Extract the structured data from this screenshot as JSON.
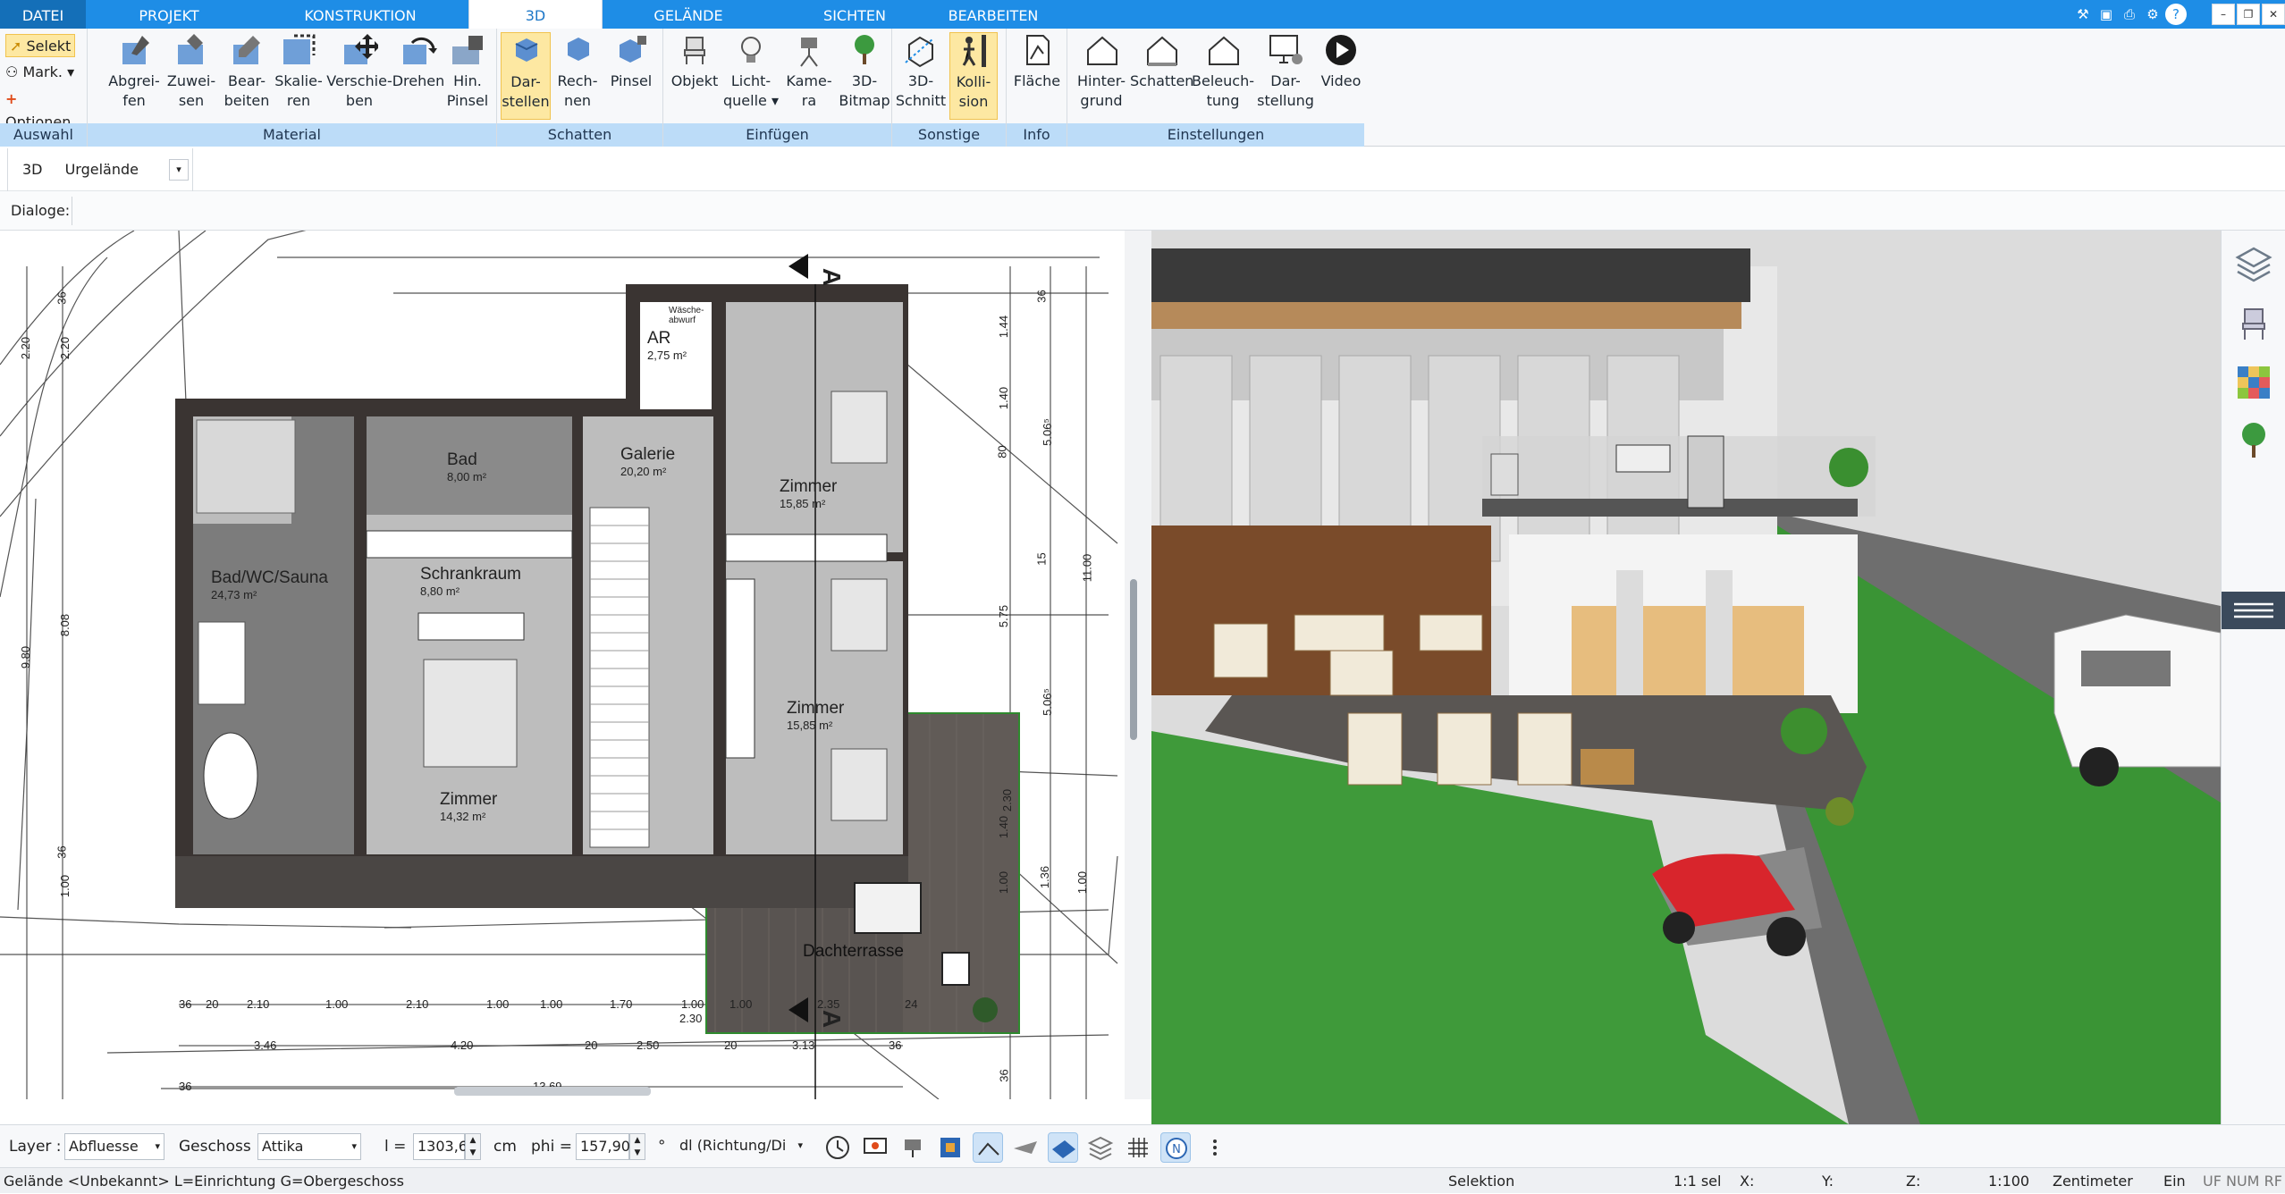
{
  "tabs": [
    "DATEI",
    "PROJEKT",
    "KONSTRUKTION",
    "3D",
    "GELÄNDE",
    "SICHTEN",
    "BEARBEITEN"
  ],
  "active_tab": "3D",
  "window_icons": [
    "tools-icon",
    "window-icon",
    "print-icon",
    "settings-icon",
    "help-icon",
    "minimize-icon",
    "restore-icon",
    "close-icon"
  ],
  "ribbon": {
    "auswahl": {
      "label": "Auswahl",
      "selekt": "Selekt",
      "mark": "Mark.",
      "optionen": "Optionen"
    },
    "material": {
      "label": "Material",
      "buttons": [
        {
          "l1": "Abgrei-",
          "l2": "fen"
        },
        {
          "l1": "Zuwei-",
          "l2": "sen"
        },
        {
          "l1": "Bear-",
          "l2": "beiten"
        },
        {
          "l1": "Skalie-",
          "l2": "ren"
        },
        {
          "l1": "Verschie-",
          "l2": "ben"
        },
        {
          "l1": "Drehen",
          "l2": ""
        },
        {
          "l1": "Hin.",
          "l2": "Pinsel"
        }
      ]
    },
    "schatten": {
      "label": "Schatten",
      "buttons": [
        {
          "l1": "Dar-",
          "l2": "stellen"
        },
        {
          "l1": "Rech-",
          "l2": "nen"
        },
        {
          "l1": "Pinsel",
          "l2": ""
        }
      ]
    },
    "einfuegen": {
      "label": "Einfügen",
      "buttons": [
        {
          "l1": "Objekt",
          "l2": ""
        },
        {
          "l1": "Licht-",
          "l2": "quelle"
        },
        {
          "l1": "Kame-",
          "l2": "ra"
        },
        {
          "l1": "3D-",
          "l2": "Bitmap"
        }
      ]
    },
    "sonstige": {
      "label": "Sonstige",
      "buttons": [
        {
          "l1": "3D-",
          "l2": "Schnitt"
        },
        {
          "l1": "Kolli-",
          "l2": "sion"
        }
      ]
    },
    "info": {
      "label": "Info",
      "buttons": [
        {
          "l1": "Fläche",
          "l2": ""
        }
      ]
    },
    "einstellungen": {
      "label": "Einstellungen",
      "buttons": [
        {
          "l1": "Hinter-",
          "l2": "grund"
        },
        {
          "l1": "Schatten",
          "l2": ""
        },
        {
          "l1": "Beleuch-",
          "l2": "tung"
        },
        {
          "l1": "Dar-",
          "l2": "stellung"
        },
        {
          "l1": "Video",
          "l2": ""
        }
      ]
    }
  },
  "options": {
    "mode": "3D",
    "terrain": "Urgelände"
  },
  "dialogs_label": "Dialoge:",
  "plan": {
    "rooms": [
      {
        "name": "Bad",
        "area": "8,00 m²"
      },
      {
        "name": "Galerie",
        "area": "20,20 m²"
      },
      {
        "name": "AR",
        "area": "2,75 m²"
      },
      {
        "name": "Zimmer",
        "area": "15,85 m²"
      },
      {
        "name": "Bad/WC/Sauna",
        "area": "24,73 m²"
      },
      {
        "name": "Schrankraum",
        "area": "8,80 m²"
      },
      {
        "name": "Zimmer",
        "area": "15,85 m²"
      },
      {
        "name": "Zimmer",
        "area": "14,32 m²"
      },
      {
        "name": "Dachterrasse",
        "area": ""
      }
    ],
    "waesche": "Wäsche-abwurf",
    "section_mark": "A",
    "dims_bottom1": [
      "36",
      "20",
      "2.10",
      "1.00",
      "2.10",
      "1.00",
      "1.00",
      "1.70",
      "1.00",
      "1.00",
      "2.35",
      "24"
    ],
    "dims_bottom2": [
      "3.46",
      "4.20",
      "20",
      "2.50",
      "2.30",
      "20",
      "3.13",
      "36"
    ],
    "dims_bottom3": [
      "36",
      "13.69"
    ],
    "dims_left": [
      "36",
      "2.20",
      "2.20",
      "8.08",
      "9.80",
      "36",
      "1.00"
    ],
    "dims_right": [
      "1.44",
      "1.40",
      "5.06⁵",
      "80",
      "15",
      "5.75",
      "11.00",
      "5.06⁵",
      "2.30",
      "1.40",
      "1.00",
      "1.36",
      "1.00",
      "36",
      "36"
    ]
  },
  "bottom": {
    "layer_label": "Layer :",
    "layer_value": "Abfluesse",
    "geschoss_label": "Geschoss :",
    "geschoss_value": "Attika",
    "l_label": "l =",
    "l_value": "1303,6",
    "l_unit": "cm",
    "phi_label": "phi =",
    "phi_value": "157,90",
    "phi_unit": "°",
    "dl_value": "dl (Richtung/Di"
  },
  "status": {
    "left": "Gelände <Unbekannt> L=Einrichtung G=Obergeschoss",
    "mode": "Selektion",
    "sel": "1:1 sel",
    "x": "X:",
    "y": "Y:",
    "z": "Z:",
    "scale": "1:100",
    "unit": "Zentimeter",
    "ein": "Ein",
    "flags": "UF NUM RF"
  },
  "colors": {
    "accent": "#1e8de6",
    "group_label": "#bcdcf8",
    "highlight": "#fde8a2",
    "grass": "#3f9a3a"
  }
}
